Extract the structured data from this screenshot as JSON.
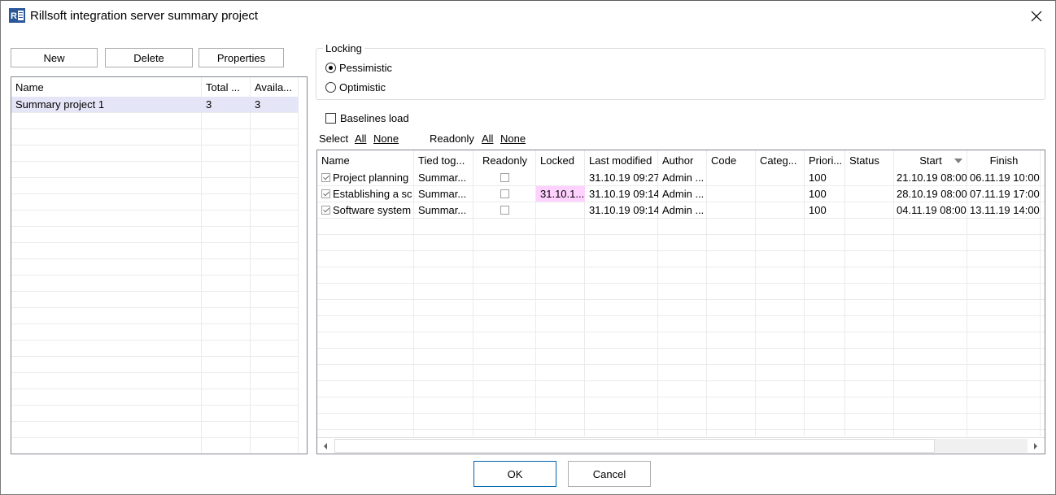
{
  "window": {
    "title": "Rillsoft integration server summary project",
    "app_icon": "rillsoft-app-icon",
    "close_icon": "close-icon"
  },
  "left": {
    "buttons": {
      "new": "New",
      "delete": "Delete",
      "properties": "Properties"
    },
    "columns": [
      "Name",
      "Total ...",
      "Availa..."
    ],
    "rows": [
      {
        "name": "Summary project 1",
        "total": "3",
        "available": "3",
        "selected": true
      }
    ]
  },
  "locking": {
    "label": "Locking",
    "options": [
      {
        "label": "Pessimistic",
        "checked": true
      },
      {
        "label": "Optimistic",
        "checked": false
      }
    ]
  },
  "baselines": {
    "label": "Baselines load",
    "checked": false
  },
  "select_bar": {
    "select_label": "Select",
    "select_all": "All",
    "select_none": "None",
    "readonly_label": "Readonly",
    "readonly_all": "All",
    "readonly_none": "None"
  },
  "grid": {
    "columns": [
      "Name",
      "Tied tog...",
      "Readonly",
      "Locked",
      "Last modified",
      "Author",
      "Code",
      "Categ...",
      "Priori...",
      "Status",
      "Start",
      "Finish"
    ],
    "sort_column": "Start",
    "sort_icon": "sort-descending-icon",
    "rows": [
      {
        "checked": true,
        "name": "Project planning",
        "tied": "Summar...",
        "readonly": false,
        "locked": "",
        "last_modified": "31.10.19 09:27",
        "author": "Admin ...",
        "code": "",
        "category": "",
        "priority": "100",
        "status": "",
        "start": "21.10.19 08:00",
        "finish": "06.11.19 10:00"
      },
      {
        "checked": true,
        "name": "Establishing a sc",
        "tied": "Summar...",
        "readonly": false,
        "locked": "31.10.1...",
        "last_modified": "31.10.19 09:14",
        "author": "Admin ...",
        "code": "",
        "category": "",
        "priority": "100",
        "status": "",
        "start": "28.10.19 08:00",
        "finish": "07.11.19 17:00"
      },
      {
        "checked": true,
        "name": "Software system",
        "tied": "Summar...",
        "readonly": false,
        "locked": "",
        "last_modified": "31.10.19 09:14",
        "author": "Admin ...",
        "code": "",
        "category": "",
        "priority": "100",
        "status": "",
        "start": "04.11.19 08:00",
        "finish": "13.11.19 14:00"
      }
    ],
    "locked_color": "#ffd1ff"
  },
  "footer": {
    "ok": "OK",
    "cancel": "Cancel"
  }
}
